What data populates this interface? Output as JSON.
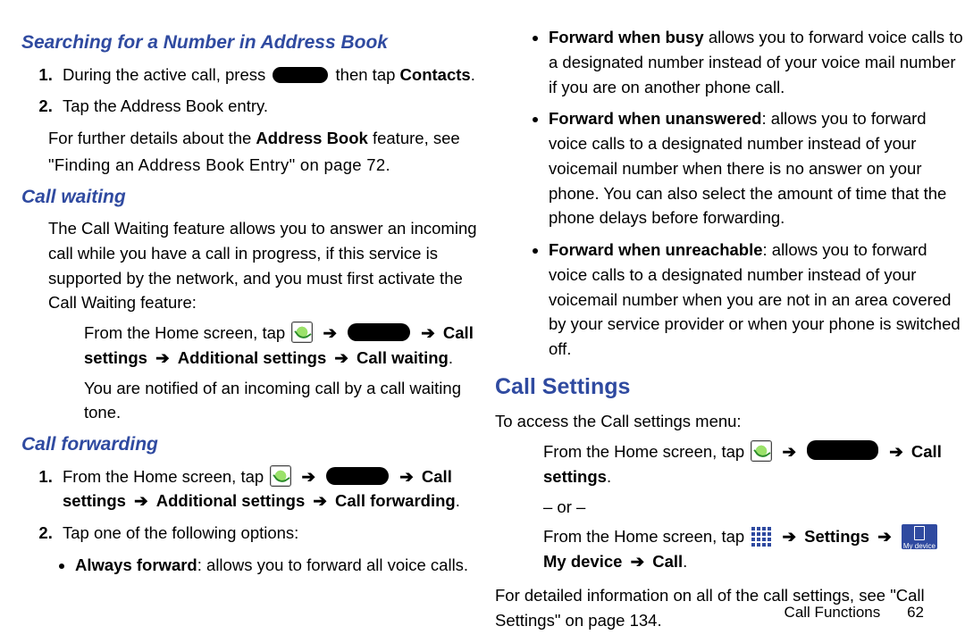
{
  "left": {
    "h_search": "Searching for a Number in Address Book",
    "search_steps": [
      {
        "pre": "During the active call, press ",
        "post": " then tap ",
        "bold_end": "Contacts",
        "tail": "."
      },
      {
        "text": "Tap the Address Book entry."
      }
    ],
    "search_para_a": "For further details about the ",
    "search_para_bold": "Address Book",
    "search_para_b": " feature, see ",
    "search_ref": "\"Finding an Address Book Entry\"",
    "search_ref_on": " on page 72.",
    "h_waiting": "Call waiting",
    "waiting_para": "The Call Waiting feature allows you to answer an incoming call while you have a call in progress, if this service is supported by the network, and you must first activate the Call Waiting feature:",
    "waiting_from": "From the Home screen, tap ",
    "waiting_path_a": "Call settings",
    "waiting_path_b": "Additional settings",
    "waiting_path_c": "Call waiting",
    "waiting_result": "You are notified of an incoming call by a call waiting tone.",
    "h_fwd": "Call forwarding",
    "fwd_from": "From the Home screen, tap ",
    "fwd_path_a": "Call settings",
    "fwd_path_b": "Additional settings",
    "fwd_path_c": "Call forwarding",
    "fwd_step2": "Tap one of the following options:",
    "fwd_opt1_b": "Always forward",
    "fwd_opt1_t": ": allows you to forward all voice calls."
  },
  "right": {
    "opt_busy_b": "Forward when busy",
    "opt_busy_t": " allows you to forward voice calls to a designated number instead of your voice mail number if you are on another phone call.",
    "opt_unans_b": "Forward when unanswered",
    "opt_unans_t": ": allows you to forward voice calls to a designated number instead of your voicemail number when there is no answer on your phone. You can also select the amount of time that the phone delays before forwarding.",
    "opt_unreach_b": "Forward when unreachable",
    "opt_unreach_t": ": allows you to forward voice calls to a designated number instead of your voicemail number when you are not in an area covered by your service provider or when your phone is switched off.",
    "h_settings": "Call Settings",
    "settings_intro": "To access the Call settings menu:",
    "from1": "From the Home screen, tap ",
    "path1": "Call settings",
    "or": "– or –",
    "from2": "From the Home screen, tap ",
    "path2a": "Settings",
    "path2b": "My device",
    "path2c": "Call",
    "detail_a": "For detailed information on all of the call settings, see ",
    "detail_ref": "\"Call Settings\"",
    "detail_b": " on page 134.",
    "mydevice_label": "My device"
  },
  "footer": {
    "section": "Call Functions",
    "page": "62"
  }
}
